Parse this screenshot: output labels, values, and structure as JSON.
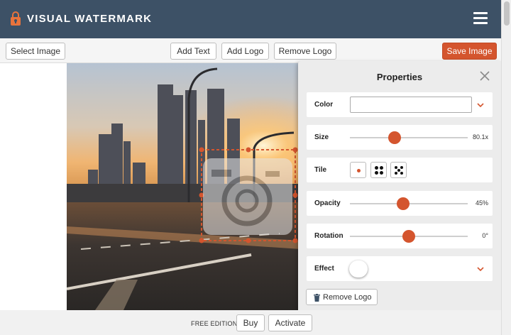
{
  "app": {
    "title": "VISUAL WATERMARK"
  },
  "icons": {
    "logo": "lock-icon",
    "menu": "hamburger-menu-icon",
    "close": "close-icon",
    "expand": "chevron-down-icon",
    "trash": "trash-icon"
  },
  "toolbar": {
    "select_image": "Select Image",
    "add_text": "Add Text",
    "add_logo": "Add Logo",
    "remove_logo": "Remove Logo",
    "save_image": "Save Image"
  },
  "properties": {
    "title": "Properties",
    "color": {
      "label": "Color",
      "value": ""
    },
    "size": {
      "label": "Size",
      "value": "80.1x",
      "position": 0.4
    },
    "tile": {
      "label": "Tile",
      "options": [
        "single-dot",
        "four-dots",
        "five-dots"
      ],
      "selected": "single-dot"
    },
    "opacity": {
      "label": "Opacity",
      "value": "45%",
      "position": 0.45
    },
    "rotation": {
      "label": "Rotation",
      "value": "0°",
      "position": 0.5
    },
    "effect": {
      "label": "Effect",
      "enabled": false
    },
    "remove_logo": "Remove Logo"
  },
  "footer": {
    "edition": "FREE EDITION",
    "buy": "Buy",
    "activate": "Activate"
  },
  "colors": {
    "header": "#3d5166",
    "accent": "#d4552e",
    "panel": "#ececec"
  }
}
